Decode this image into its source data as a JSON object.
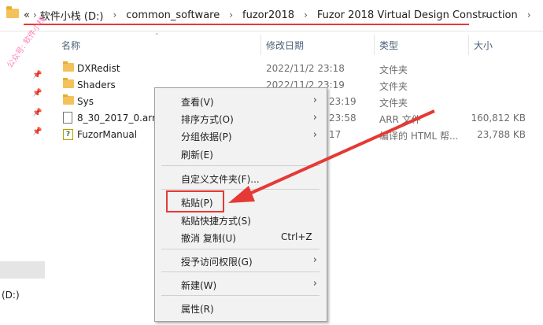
{
  "addressbar": {
    "crumbs": [
      "软件小栈 (D:)",
      "common_software",
      "fuzor2018",
      "Fuzor 2018 Virtual Design Construction"
    ],
    "prefix": "«"
  },
  "sidebar": {
    "drive_label": "(D:)"
  },
  "columns": {
    "name": "名称",
    "date": "修改日期",
    "type": "类型",
    "size": "大小"
  },
  "files": [
    {
      "name": "DXRedist",
      "date": "2022/11/2 23:18",
      "type": "文件夹",
      "size": "",
      "icon": "folder-icon"
    },
    {
      "name": "Shaders",
      "date": "2022/11/2 23:19",
      "type": "文件夹",
      "size": "",
      "icon": "folder-icon"
    },
    {
      "name": "Sys",
      "date": "23:19",
      "type": "文件夹",
      "size": "",
      "icon": "folder-icon"
    },
    {
      "name": "8_30_2017_0.arr",
      "date": "23:58",
      "type": "ARR 文件",
      "size": "160,812 KB",
      "icon": "file-icon"
    },
    {
      "name": "FuzorManual",
      "date": "17",
      "type": "编译的 HTML 帮...",
      "size": "23,788 KB",
      "icon": "help-file-icon"
    }
  ],
  "context_menu": {
    "view": "查看(V)",
    "sort": "排序方式(O)",
    "group": "分组依据(P)",
    "refresh": "刷新(E)",
    "customize": "自定义文件夹(F)...",
    "paste": "粘贴(P)",
    "paste_shortcut": "粘贴快捷方式(S)",
    "undo": "撤消 复制(U)",
    "undo_shortcut": "Ctrl+Z",
    "access": "授予访问权限(G)",
    "new": "新建(W)",
    "properties": "属性(R)"
  },
  "watermark": "公众号: 软件小栈",
  "colors": {
    "highlight": "#e53935",
    "menu_bg": "#f2f2f2",
    "folder": "#f4c25b"
  }
}
